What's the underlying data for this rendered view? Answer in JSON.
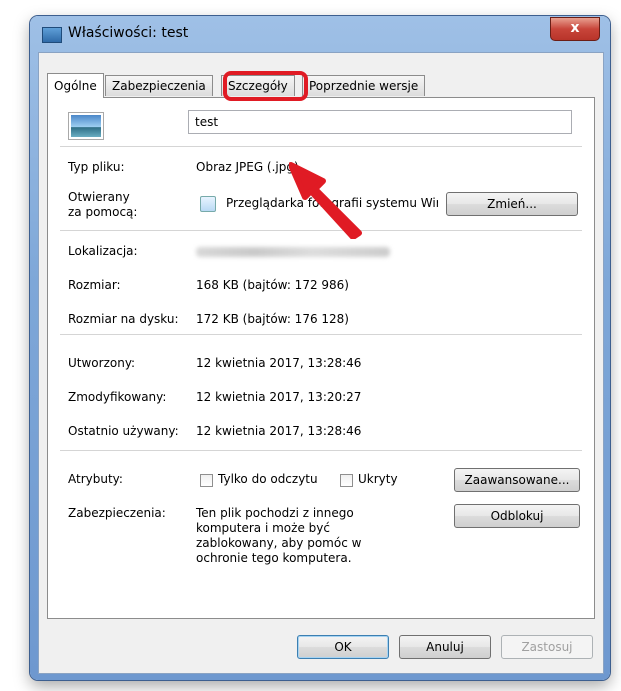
{
  "window": {
    "title": "Właściwości: test",
    "close_glyph": "x"
  },
  "tabs": [
    {
      "label": "Ogólne",
      "active": true
    },
    {
      "label": "Zabezpieczenia",
      "active": false
    },
    {
      "label": "Szczegóły",
      "active": false,
      "highlighted": true
    },
    {
      "label": "Poprzednie wersje",
      "active": false
    }
  ],
  "general": {
    "file_name": "test",
    "file_type_label": "Typ pliku:",
    "file_type_value": "Obraz JPEG (.jpg)",
    "opens_with_label_line1": "Otwierany",
    "opens_with_label_line2": "za pomocą:",
    "opens_with_value": "Przeglądarka fotografii systemu Wir",
    "change_button": "Zmień...",
    "location_label": "Lokalizacja:",
    "size_label": "Rozmiar:",
    "size_value": "168 KB (bajtów: 172 986)",
    "size_on_disk_label": "Rozmiar na dysku:",
    "size_on_disk_value": "172 KB (bajtów: 176 128)",
    "created_label": "Utworzony:",
    "created_value": "12 kwietnia 2017, 13:28:46",
    "modified_label": "Zmodyfikowany:",
    "modified_value": "12 kwietnia 2017, 13:20:27",
    "accessed_label": "Ostatnio używany:",
    "accessed_value": "12 kwietnia 2017, 13:28:46",
    "attributes_label": "Atrybuty:",
    "readonly_label": "Tylko do odczytu",
    "hidden_label": "Ukryty",
    "advanced_button": "Zaawansowane...",
    "security_label": "Zabezpieczenia:",
    "security_text_line1": "Ten plik pochodzi z innego",
    "security_text_line2": "komputera i może być",
    "security_text_line3": "zablokowany, aby pomóc w",
    "security_text_line4": "ochronie tego komputera.",
    "unblock_button": "Odblokuj"
  },
  "footer": {
    "ok_button": "OK",
    "cancel_button": "Anuluj",
    "apply_button": "Zastosuj"
  },
  "colors": {
    "highlight": "#e01b24",
    "client_bg": "#f0f0f0",
    "frame": "#7ea7d8"
  },
  "icons": {
    "window_icon": "image-file-icon",
    "app_icon": "photo-viewer-icon",
    "annotation": "red-arrow-annotation"
  }
}
